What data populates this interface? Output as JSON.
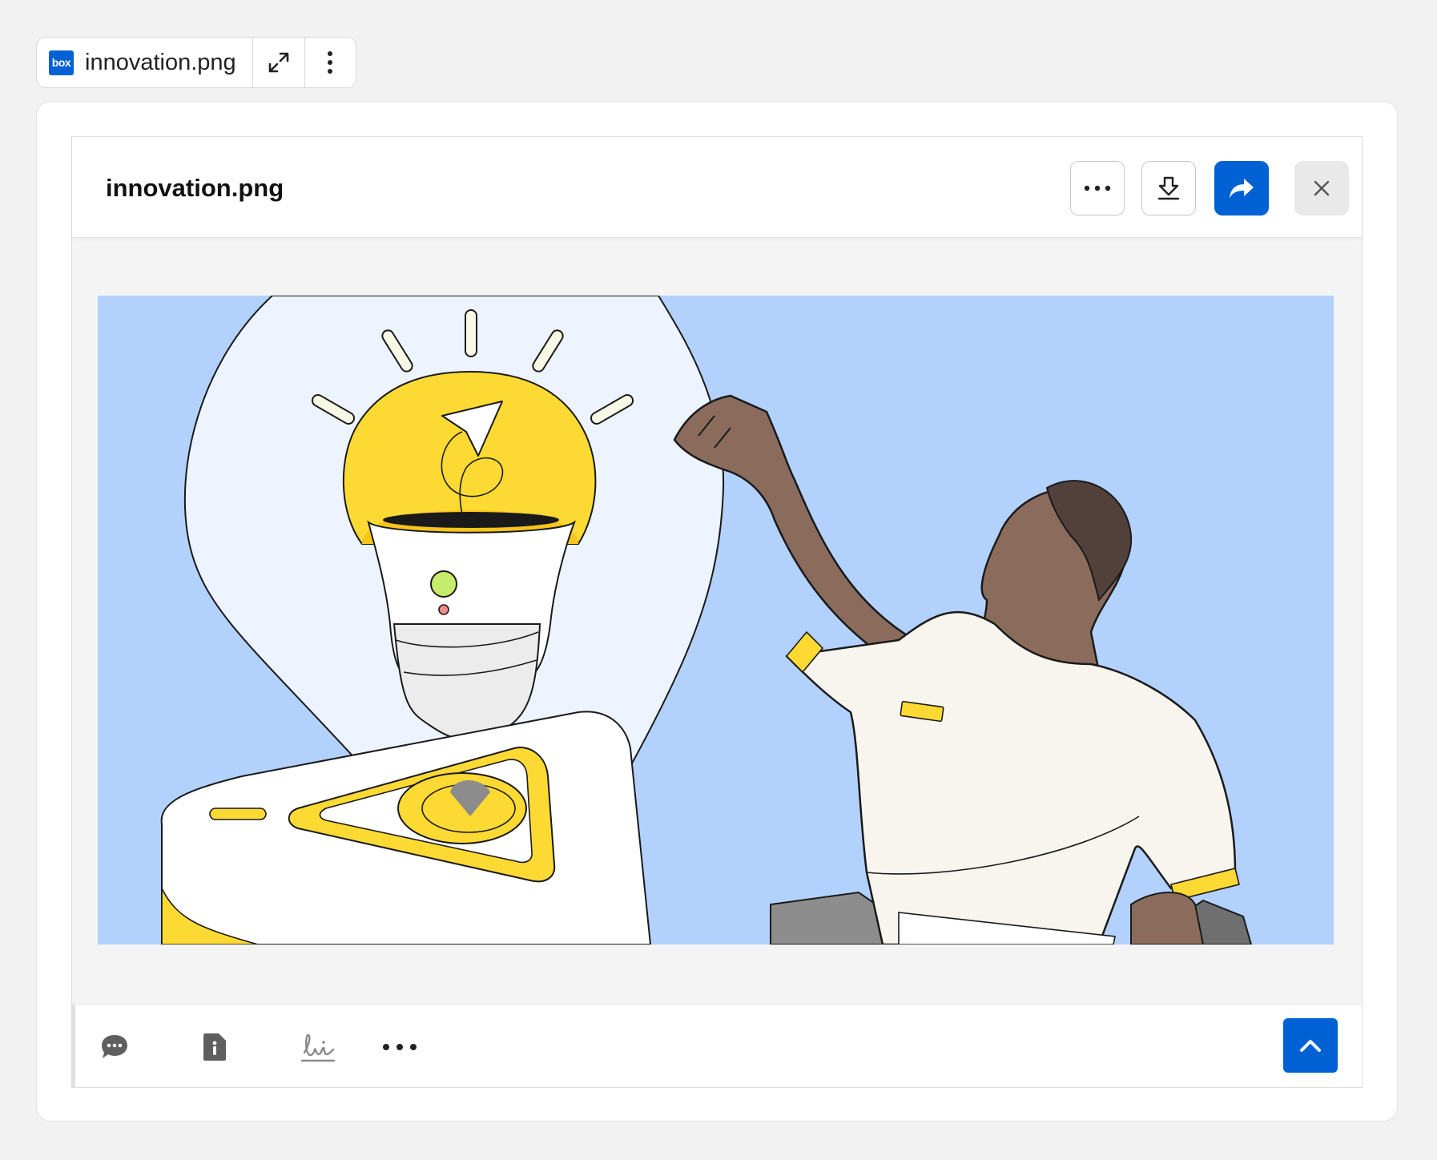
{
  "tab": {
    "logo_text": "box",
    "filename": "innovation.png",
    "icons": [
      "box-logo-icon",
      "expand-icon",
      "kebab-vertical-icon"
    ]
  },
  "preview": {
    "title": "innovation.png",
    "header_icons": [
      "more-horizontal-icon",
      "download-icon",
      "share-arrow-icon",
      "close-icon"
    ],
    "footer_icons": [
      "comment-icon",
      "file-info-icon",
      "signature-icon",
      "more-horizontal-icon",
      "chevron-up-icon"
    ]
  },
  "colors": {
    "accent": "#0061d5",
    "image_background": "#b3d1fd",
    "bulb_yellow": "#fdda33",
    "skin": "#8b6c5c"
  }
}
